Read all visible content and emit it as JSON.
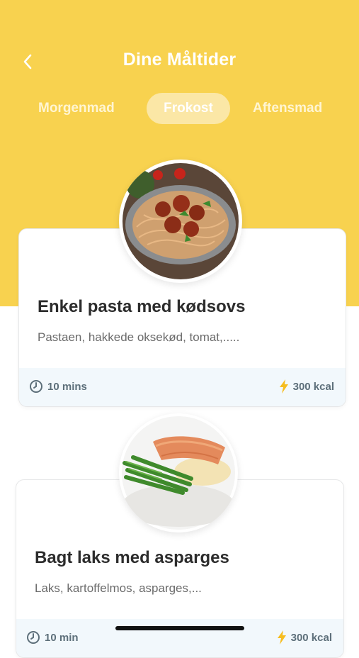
{
  "header": {
    "title": "Dine Måltider",
    "back_icon": "chevron-left-icon"
  },
  "tabs": [
    {
      "label": "Morgenmad",
      "active": false
    },
    {
      "label": "Frokost",
      "active": true
    },
    {
      "label": "Aftensmad",
      "active": false
    }
  ],
  "colors": {
    "accent": "#f8d24f",
    "text_dark": "#2c2c2c",
    "meta": "#5d6f7a",
    "kcal_icon": "#f6bd1f"
  },
  "meals": [
    {
      "title": "Enkel pasta med kødsovs",
      "description": "Pastaen, hakkede oksekød, tomat,.....",
      "time": "10 mins",
      "kcal": "300 kcal",
      "image_icon": "pasta-meatballs-image"
    },
    {
      "title": "Bagt laks med asparges",
      "description": "Laks, kartoffelmos, asparges,...",
      "time": "10 min",
      "kcal": "300 kcal",
      "image_icon": "salmon-asparagus-image"
    }
  ]
}
